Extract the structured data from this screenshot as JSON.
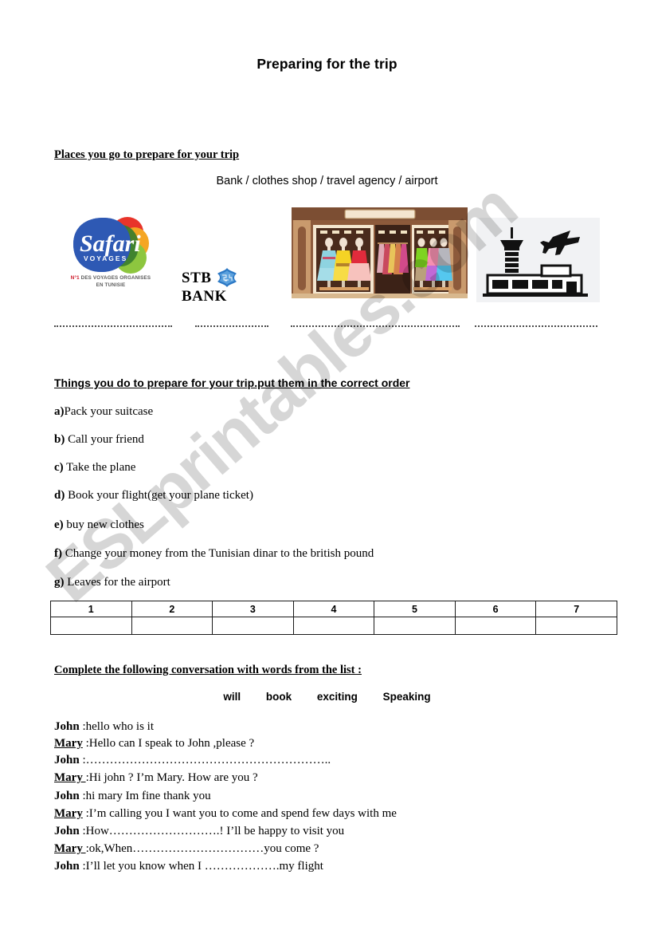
{
  "document": {
    "title": "Preparing for the trip",
    "watermark": "ESLprintables.com"
  },
  "section_places": {
    "heading": "Places  you go to prepare for your trip",
    "options_line": "Bank /   clothes shop /   travel  agency  /  airport",
    "images": [
      {
        "name": "travel-agency-logo",
        "brand": "Safari",
        "sub": "VOYAGES",
        "tagline_prefix": "N°1",
        "tagline_rest": " DES VOYAGES ORGANISES",
        "tagline_line2": "EN TUNISIE"
      },
      {
        "name": "bank-logo",
        "left_word": "STB",
        "right_word": "BANK"
      },
      {
        "name": "clothes-shop-photo"
      },
      {
        "name": "airport-icon"
      }
    ]
  },
  "section_order": {
    "heading": "Things you do to prepare for your trip.put them in the correct order",
    "items": [
      {
        "letter": "a)",
        "text": "Pack your suitcase",
        "gap": ""
      },
      {
        "letter": "b)",
        "text": "Call your friend",
        "gap": " "
      },
      {
        "letter": "c)",
        "text": "Take the plane",
        "gap": " "
      },
      {
        "letter": "d)",
        "text": "Book your flight(get your plane ticket)",
        "gap": " "
      },
      {
        "letter": "e)",
        "text": "buy new clothes",
        "gap": " "
      },
      {
        "letter": "f)",
        "text": "Change your money from the Tunisian dinar to the british pound",
        "gap": " "
      },
      {
        "letter": "g)",
        "text": "Leaves for the airport",
        "gap": " "
      }
    ],
    "table_headers": [
      "1",
      "2",
      "3",
      "4",
      "5",
      "6",
      "7"
    ],
    "table_answers": [
      "",
      "",
      "",
      "",
      "",
      "",
      ""
    ]
  },
  "section_conversation": {
    "heading": "Complete the following conversation with words from the list :",
    "word_bank": [
      "will",
      "book",
      "exciting",
      "Speaking"
    ],
    "lines": [
      {
        "speaker": "John",
        "underline": false,
        "text": " :hello who is it"
      },
      {
        "speaker": "Mary",
        "underline": true,
        "text": " :Hello can I speak to John ,please ?"
      },
      {
        "speaker": "John",
        "underline": false,
        "text": " :…………………………………………………….."
      },
      {
        "speaker": "Mary ",
        "underline": true,
        "text": ":Hi john ? I’m Mary. How are you ?"
      },
      {
        "speaker": "John",
        "underline": false,
        "text": " :hi mary Im fine thank you"
      },
      {
        "speaker": "Mary",
        "underline": true,
        "text": " :I’m calling you I want you to come and spend few days with me"
      },
      {
        "speaker": "John",
        "underline": false,
        "text": " :How……………………….! I’ll be happy to visit you"
      },
      {
        "speaker": "Mary ",
        "underline": true,
        "text": ":ok,When……………………………you come ?"
      },
      {
        "speaker": "John",
        "underline": false,
        "text": " :I’ll let you know when I ……………….my flight"
      }
    ]
  }
}
